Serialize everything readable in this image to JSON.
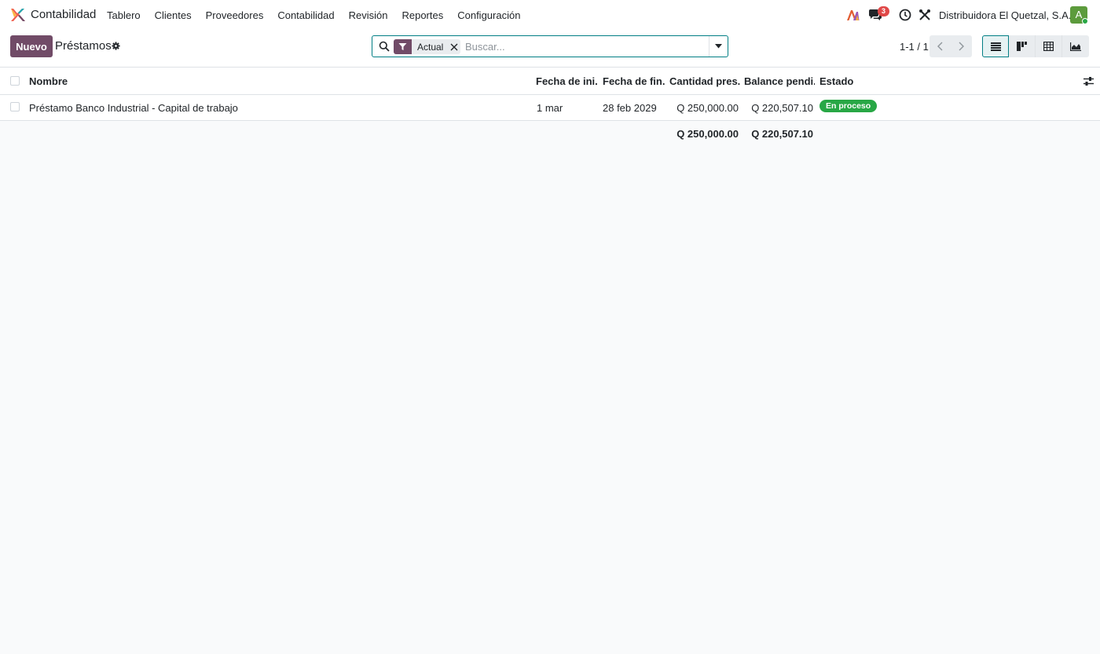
{
  "app": {
    "name": "Contabilidad",
    "logo_icon": "odoo-app-logo"
  },
  "menu": {
    "items": [
      {
        "label": "Tablero"
      },
      {
        "label": "Clientes"
      },
      {
        "label": "Proveedores"
      },
      {
        "label": "Contabilidad"
      },
      {
        "label": "Revisión"
      },
      {
        "label": "Reportes"
      },
      {
        "label": "Configuración"
      }
    ]
  },
  "systray": {
    "chat_count": "3",
    "company": "Distribuidora El Quetzal, S.A.",
    "avatar_letter": "A",
    "avatar_color": "#5c9b3c"
  },
  "control_panel": {
    "new_label": "Nuevo",
    "title": "Préstamos",
    "search": {
      "facet_label": "Actual",
      "placeholder": "Buscar..."
    },
    "pager": "1-1 / 1"
  },
  "table": {
    "headers": {
      "name": "Nombre",
      "start_date": "Fecha de ini...",
      "end_date": "Fecha de fin...",
      "amount": "Cantidad pres...",
      "balance": "Balance pendi...",
      "state": "Estado"
    },
    "rows": [
      {
        "name": "Préstamo Banco Industrial - Capital de trabajo",
        "start_date": "1 mar",
        "end_date": "28 feb 2029",
        "amount": "Q 250,000.00",
        "balance": "Q 220,507.10",
        "state": "En proceso"
      }
    ],
    "totals": {
      "amount": "Q 250,000.00",
      "balance": "Q 220,507.10"
    }
  },
  "colors": {
    "primary": "#714b67",
    "accent": "#017e84",
    "status_success": "#28a745",
    "badge": "#e04848"
  }
}
